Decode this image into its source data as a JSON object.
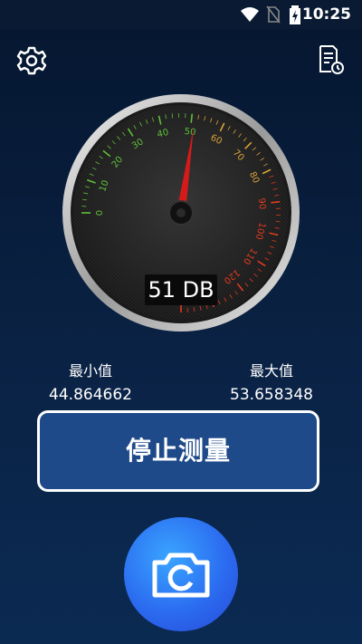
{
  "status_bar": {
    "time": "10:25"
  },
  "gauge": {
    "ticks_green": [
      "0",
      "10",
      "20",
      "30",
      "40",
      "50"
    ],
    "ticks_orange": [
      "60",
      "70",
      "80"
    ],
    "ticks_red": [
      "90",
      "100",
      "110",
      "120",
      "130",
      "140"
    ],
    "current_db": 51,
    "readout": "51 DB",
    "max_scale": 140
  },
  "stats": {
    "min_label": "最小值",
    "min_value": "44.864662",
    "max_label": "最大值",
    "max_value": "53.658348"
  },
  "actions": {
    "stop_label": "停止测量"
  },
  "icons": {
    "settings": "gear-icon",
    "history": "history-document-icon",
    "camera": "camera-icon"
  },
  "colors": {
    "background": "#0a2244",
    "button": "#1e4a8a",
    "green_ticks": "#5fbf3a",
    "orange_ticks": "#d8a23a",
    "red_ticks": "#e23b1e",
    "needle": "#d61a1a"
  }
}
